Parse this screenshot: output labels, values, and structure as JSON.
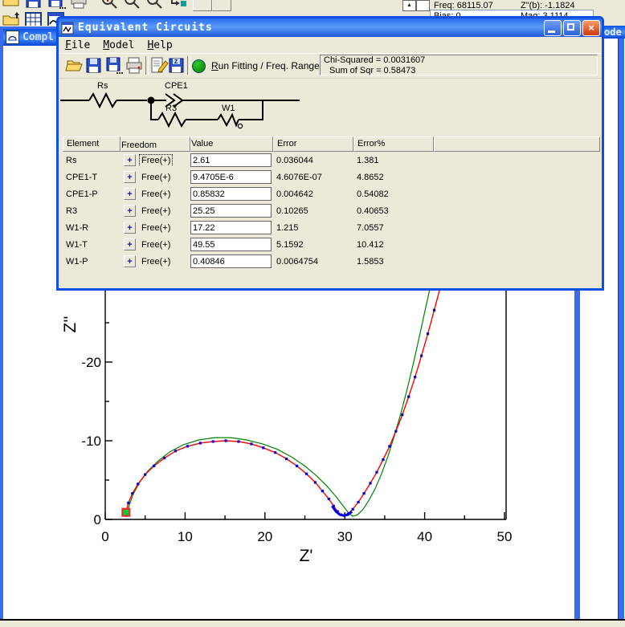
{
  "app": {
    "status": {
      "freq": "Freq: 68115.07",
      "zb": "Z\"(b): -1.1824",
      "bias": "Bias: 0",
      "mag": "Mag: 3.1114"
    },
    "background_windows": {
      "complex_title_fragment": "Compl",
      "bode_title_fragment": "ode"
    }
  },
  "dialog": {
    "title": "Equivalent Circuits",
    "menu": [
      "File",
      "Model",
      "Help"
    ],
    "toolbar": {
      "run_label": "Run Fitting / Freq. Range",
      "chi_squared": "Chi-Squared = 0.0031607",
      "sum_sqr": "Sum of Sqr = 0.58473",
      "z_disk_glyph": "Z"
    },
    "circuit": {
      "rs": "Rs",
      "cpe": "CPE1",
      "r3": "R3",
      "w1": "W1"
    },
    "table": {
      "plus_glyph": "+",
      "headers": [
        "Element",
        "Freedom",
        "Value",
        "Error",
        "Error%"
      ],
      "rows": [
        {
          "element": "Rs",
          "freedom": "Free(+)",
          "value": "2.61",
          "error": "0.036044",
          "error_pct": "1.381"
        },
        {
          "element": "CPE1-T",
          "freedom": "Free(+)",
          "value": "9.4705E-6",
          "error": "4.6076E-07",
          "error_pct": "4.8652"
        },
        {
          "element": "CPE1-P",
          "freedom": "Free(+)",
          "value": "0.85832",
          "error": "0.004642",
          "error_pct": "0.54082"
        },
        {
          "element": "R3",
          "freedom": "Free(+)",
          "value": "25.25",
          "error": "0.10265",
          "error_pct": "0.40653"
        },
        {
          "element": "W1-R",
          "freedom": "Free(+)",
          "value": "17.22",
          "error": "1.215",
          "error_pct": "7.0557"
        },
        {
          "element": "W1-T",
          "freedom": "Free(+)",
          "value": "49.55",
          "error": "5.1592",
          "error_pct": "10.412"
        },
        {
          "element": "W1-P",
          "freedom": "Free(+)",
          "value": "0.40846",
          "error": "0.0064754",
          "error_pct": "1.5853"
        }
      ]
    }
  },
  "chart_data": {
    "type": "scatter",
    "title": "",
    "xlabel": "Z'",
    "ylabel": "Z''",
    "xlim": [
      0,
      50
    ],
    "ylim": [
      0,
      -30
    ],
    "x_ticks": [
      0,
      10,
      20,
      30,
      40,
      50
    ],
    "x_minor": [
      5,
      15,
      25,
      35,
      45
    ],
    "y_ticks": [
      0,
      -10,
      -20
    ],
    "y_minor": [
      -5,
      -15,
      -25
    ],
    "grid": false,
    "legend": "none",
    "series": [
      {
        "name": "fit-curve",
        "type": "line",
        "color": "#008000",
        "width": 1.2,
        "points": [
          [
            2.6,
            -0.3
          ],
          [
            3.0,
            -1.8
          ],
          [
            3.5,
            -3.2
          ],
          [
            4.3,
            -4.7
          ],
          [
            5.3,
            -6.1
          ],
          [
            6.6,
            -7.4
          ],
          [
            8.1,
            -8.6
          ],
          [
            9.8,
            -9.5
          ],
          [
            11.7,
            -10.1
          ],
          [
            13.7,
            -10.4
          ],
          [
            15.7,
            -10.4
          ],
          [
            17.7,
            -10.1
          ],
          [
            19.7,
            -9.6
          ],
          [
            21.6,
            -8.9
          ],
          [
            23.4,
            -7.9
          ],
          [
            25.0,
            -6.8
          ],
          [
            26.5,
            -5.5
          ],
          [
            27.8,
            -4.2
          ],
          [
            28.9,
            -2.9
          ],
          [
            29.8,
            -1.7
          ],
          [
            30.5,
            -0.8
          ],
          [
            31.0,
            -0.4
          ],
          [
            31.6,
            -0.6
          ],
          [
            32.3,
            -1.3
          ],
          [
            33.0,
            -2.4
          ],
          [
            33.8,
            -3.9
          ],
          [
            34.6,
            -5.8
          ],
          [
            35.4,
            -8.0
          ],
          [
            36.2,
            -10.6
          ],
          [
            37.0,
            -13.4
          ],
          [
            37.8,
            -16.5
          ],
          [
            38.6,
            -19.9
          ],
          [
            39.4,
            -23.5
          ],
          [
            40.1,
            -26.8
          ],
          [
            40.8,
            -30.0
          ]
        ]
      },
      {
        "name": "experimental-data",
        "type": "line+marker",
        "color": "#ff0000",
        "width": 1.4,
        "marker_color": "#0000dd",
        "marker_size": 3.2,
        "points": [
          [
            2.6,
            -0.9
          ],
          [
            2.9,
            -2.1
          ],
          [
            3.4,
            -3.3
          ],
          [
            4.1,
            -4.5
          ],
          [
            5.0,
            -5.7
          ],
          [
            6.1,
            -6.8
          ],
          [
            7.4,
            -7.8
          ],
          [
            8.8,
            -8.7
          ],
          [
            10.3,
            -9.3
          ],
          [
            11.9,
            -9.7
          ],
          [
            13.5,
            -9.9
          ],
          [
            15.1,
            -10.0
          ],
          [
            16.7,
            -9.9
          ],
          [
            18.3,
            -9.6
          ],
          [
            19.8,
            -9.1
          ],
          [
            21.3,
            -8.5
          ],
          [
            22.7,
            -7.7
          ],
          [
            24.0,
            -6.8
          ],
          [
            25.2,
            -5.8
          ],
          [
            26.3,
            -4.7
          ],
          [
            27.2,
            -3.6
          ],
          [
            28.0,
            -2.6
          ],
          [
            28.6,
            -1.7
          ],
          [
            29.1,
            -1.0
          ],
          [
            29.5,
            -0.6
          ],
          [
            29.9,
            -0.5
          ],
          [
            30.4,
            -0.7
          ],
          [
            31.0,
            -1.3
          ],
          [
            31.7,
            -2.2
          ],
          [
            32.4,
            -3.3
          ],
          [
            33.2,
            -4.6
          ],
          [
            34.0,
            -6.0
          ],
          [
            34.8,
            -7.6
          ],
          [
            35.6,
            -9.3
          ],
          [
            36.4,
            -11.2
          ],
          [
            37.2,
            -13.3
          ],
          [
            38.0,
            -15.6
          ],
          [
            38.8,
            -18.1
          ],
          [
            39.6,
            -20.8
          ],
          [
            40.4,
            -23.6
          ],
          [
            41.2,
            -26.6
          ],
          [
            41.9,
            -29.3
          ]
        ]
      },
      {
        "name": "dip-cluster",
        "type": "thickline",
        "color": "#0000dd",
        "width": 3,
        "points": [
          [
            28.4,
            -1.7
          ],
          [
            28.9,
            -1.0
          ],
          [
            29.4,
            -0.6
          ],
          [
            29.9,
            -0.5
          ],
          [
            30.4,
            -0.6
          ],
          [
            30.9,
            -1.0
          ]
        ]
      },
      {
        "name": "start-point",
        "type": "start-marker",
        "fill": "#00cc33",
        "border": "#ff2020",
        "size": 9,
        "points": [
          [
            2.6,
            -0.9
          ]
        ]
      }
    ]
  }
}
